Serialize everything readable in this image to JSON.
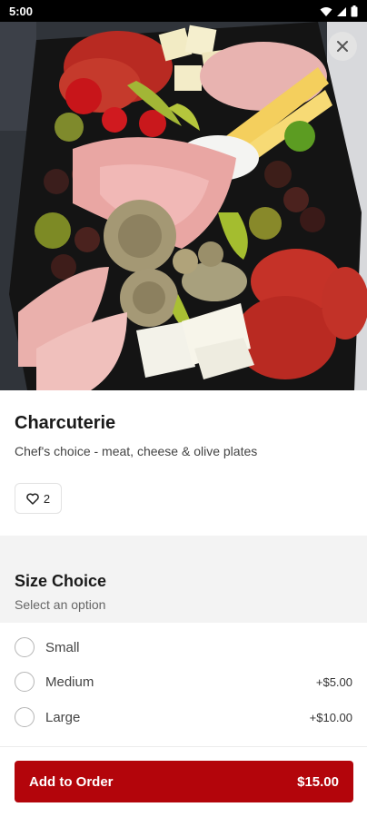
{
  "status_bar": {
    "time": "5:00"
  },
  "item": {
    "title": "Charcuterie",
    "description": "Chef's choice - meat, cheese & olive plates",
    "likes": "2"
  },
  "size_section": {
    "title": "Size Choice",
    "subtitle": "Select an option",
    "options": [
      {
        "label": "Small",
        "price": ""
      },
      {
        "label": "Medium",
        "price": "+$5.00"
      },
      {
        "label": "Large",
        "price": "+$10.00"
      }
    ]
  },
  "order_button": {
    "label": "Add to Order",
    "price": "$15.00"
  },
  "icons": {
    "close": "close-icon",
    "like": "heart-icon"
  },
  "colors": {
    "accent": "#b3050b",
    "section_bg": "#f3f3f3"
  }
}
